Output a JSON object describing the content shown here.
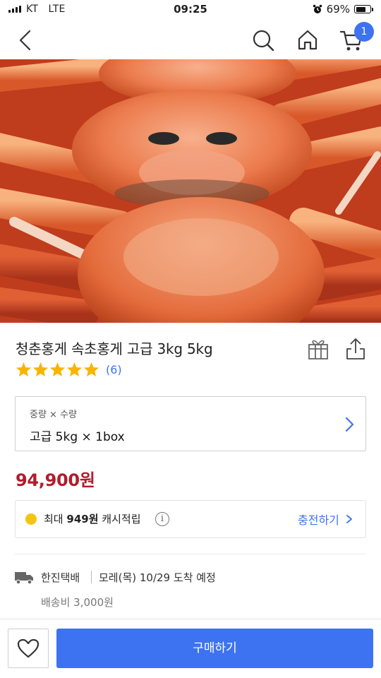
{
  "status_bar": {
    "carrier": "KT",
    "network": "LTE",
    "time": "09:25",
    "battery_percent": "69%",
    "battery_level": 0.69
  },
  "nav": {
    "cart_count": "1",
    "icons": [
      "back-icon",
      "search-icon",
      "home-icon",
      "cart-icon"
    ]
  },
  "product": {
    "title": "청춘홍게 속초홍게 고급 3kg 5kg",
    "rating": 5,
    "review_count": "(6)",
    "price": "94,900원"
  },
  "option": {
    "label": "중량 × 수량",
    "value": "고급 5kg × 1box"
  },
  "cashback": {
    "prefix": "최대",
    "amount": "949원",
    "suffix": "캐시적립",
    "charge_label": "충전하기"
  },
  "delivery": {
    "courier": "한진택배",
    "arrival": "모레(목) 10/29 도착 예정",
    "shipping_fee": "배송비 3,000원"
  },
  "bottom": {
    "buy_label": "구매하기"
  },
  "colors": {
    "accent": "#3d73f0",
    "price": "#b11c2c",
    "star": "#f7b500",
    "coin": "#f4c40f"
  }
}
